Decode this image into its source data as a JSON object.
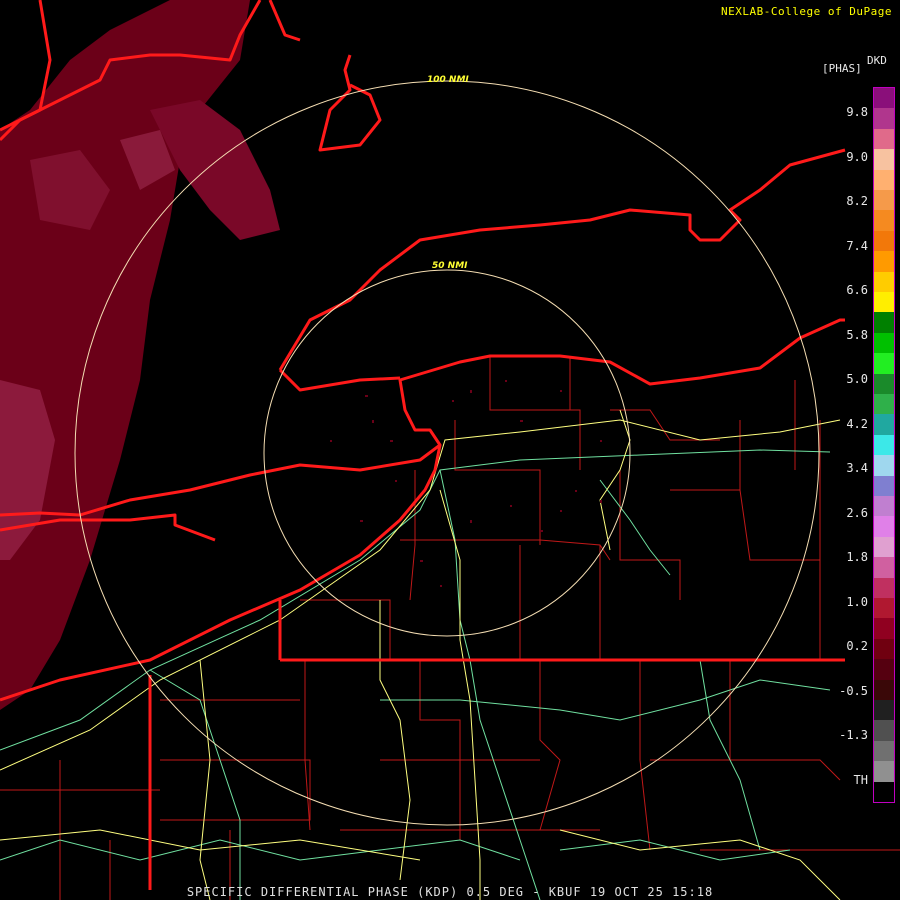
{
  "header": {
    "credit": "NEXLAB-College of DuPage"
  },
  "footer": {
    "caption": "SPECIFIC DIFFERENTIAL PHASE (KDP) 0.5 DEG - KBUF 19 OCT 25 15:18"
  },
  "legend": {
    "product": "DKD",
    "unit": "[PHAS]",
    "ticks": [
      "9.8",
      "9.0",
      "8.2",
      "7.4",
      "6.6",
      "5.8",
      "5.0",
      "4.2",
      "3.4",
      "2.6",
      "1.8",
      "1.0",
      "0.2",
      "-0.5",
      "-1.3",
      "TH"
    ],
    "colors": [
      "#8a0f7a",
      "#b0368d",
      "#e06a8a",
      "#f7c2a0",
      "#ffb070",
      "#f59a4a",
      "#f58a20",
      "#f2780a",
      "#ff9a00",
      "#ffcc00",
      "#ffee00",
      "#008000",
      "#00c000",
      "#22ee22",
      "#1a8a2a",
      "#2fb04a",
      "#20a8a0",
      "#3ce8e8",
      "#9fd7ee",
      "#7f7fd0",
      "#c07fd0",
      "#e080e8",
      "#e0a0d0",
      "#d060a0",
      "#c03060",
      "#b01830",
      "#900020",
      "#700010",
      "#550010",
      "#3a0808",
      "#202020",
      "#505050",
      "#707070",
      "#909090",
      "#000000"
    ]
  },
  "range_rings": [
    {
      "label": "50 NMI"
    },
    {
      "label": "100 NMI"
    }
  ],
  "colors": {
    "background": "#000000",
    "state_border": "#ff1a1a",
    "county": "#c01818",
    "ring": "#f5deb3",
    "ring_label": "#ffff33",
    "highway_green": "#70e0a0",
    "highway_yellow": "#ffff80",
    "echo": "#6b0018",
    "echo_light": "#8c1a3c"
  }
}
